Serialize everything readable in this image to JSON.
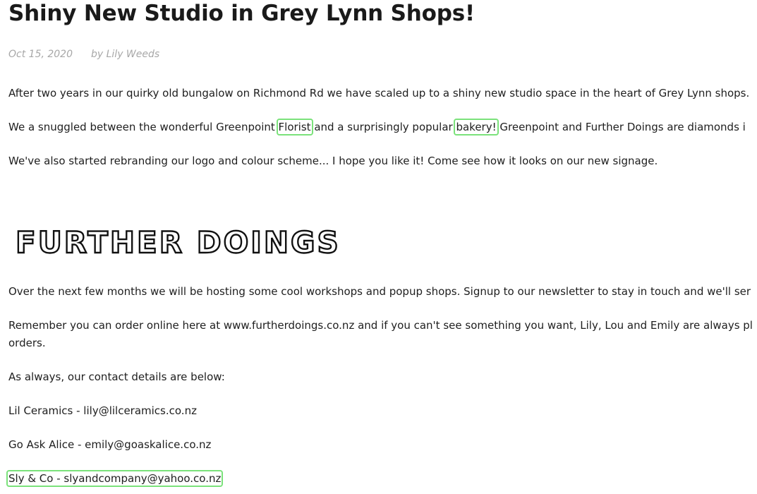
{
  "post": {
    "title": "Shiny New Studio in Grey Lynn Shops!",
    "date": "Oct 15, 2020",
    "author": "by Lily Weeds",
    "p1": "After two years in our quirky old bungalow on Richmond Rd we have scaled up to a shiny new studio space in the heart of Grey Lynn shops.",
    "p2": {
      "text_before_florist": "We a snuggled between the wonderful Greenpoint ",
      "florist_link": "Florist",
      "text_middle": " and a surprisingly popular ",
      "bakery_link": "bakery!",
      "text_after": " Greenpoint and Further Doings are diamonds i"
    },
    "p3": "We've also started rebranding our logo and colour scheme... I hope you like it! Come see how it looks on our new signage.",
    "logo_text": "FURTHER DOINGS",
    "p4": "Over the next few months we will be hosting some cool workshops and popup shops. Signup to our newsletter to stay in touch and we'll ser",
    "p5_line1": "Remember you can order online here at www.furtherdoings.co.nz and if you can't see something you want, Lily, Lou and Emily are always pl",
    "p5_line2": "orders.",
    "p6": "As always, our contact details are below:",
    "contacts": [
      "Lil Ceramics - lily@lilceramics.co.nz",
      "Go Ask Alice - emily@goaskalice.co.nz",
      "Sly & Co - slyandcompany@yahoo.co.nz"
    ]
  },
  "colors": {
    "highlight_outline": "#7be27b",
    "meta_text": "#a8a8a8",
    "body_text": "#1e1e1e"
  }
}
